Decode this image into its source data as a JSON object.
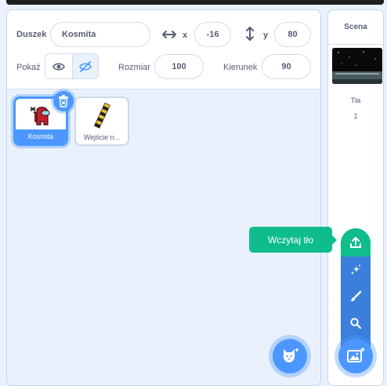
{
  "sprite_info": {
    "sprite_label": "Duszek",
    "sprite_name": "Kosmita",
    "x_label": "x",
    "x_value": "-16",
    "y_label": "y",
    "y_value": "80",
    "show_label": "Pokaż",
    "size_label": "Rozmiar",
    "size_value": "100",
    "direction_label": "Kierunek",
    "direction_value": "90"
  },
  "sprites": [
    {
      "name": "Kosmita",
      "selected": true,
      "icon": "red-crewmate-icon"
    },
    {
      "name": "Wejście n...",
      "selected": false,
      "icon": "striped-barrier-icon"
    }
  ],
  "stage": {
    "title": "Scena",
    "backdrops_label": "Tła",
    "backdrops_count": "1"
  },
  "backdrop_menu": {
    "tooltip": "Wczytaj tło",
    "items": [
      "upload-icon",
      "surprise-icon",
      "paint-icon",
      "search-icon"
    ]
  },
  "colors": {
    "accent": "#4c97ff",
    "upload_green": "#0fbd8c",
    "panel_bg": "#e9f1fc"
  }
}
